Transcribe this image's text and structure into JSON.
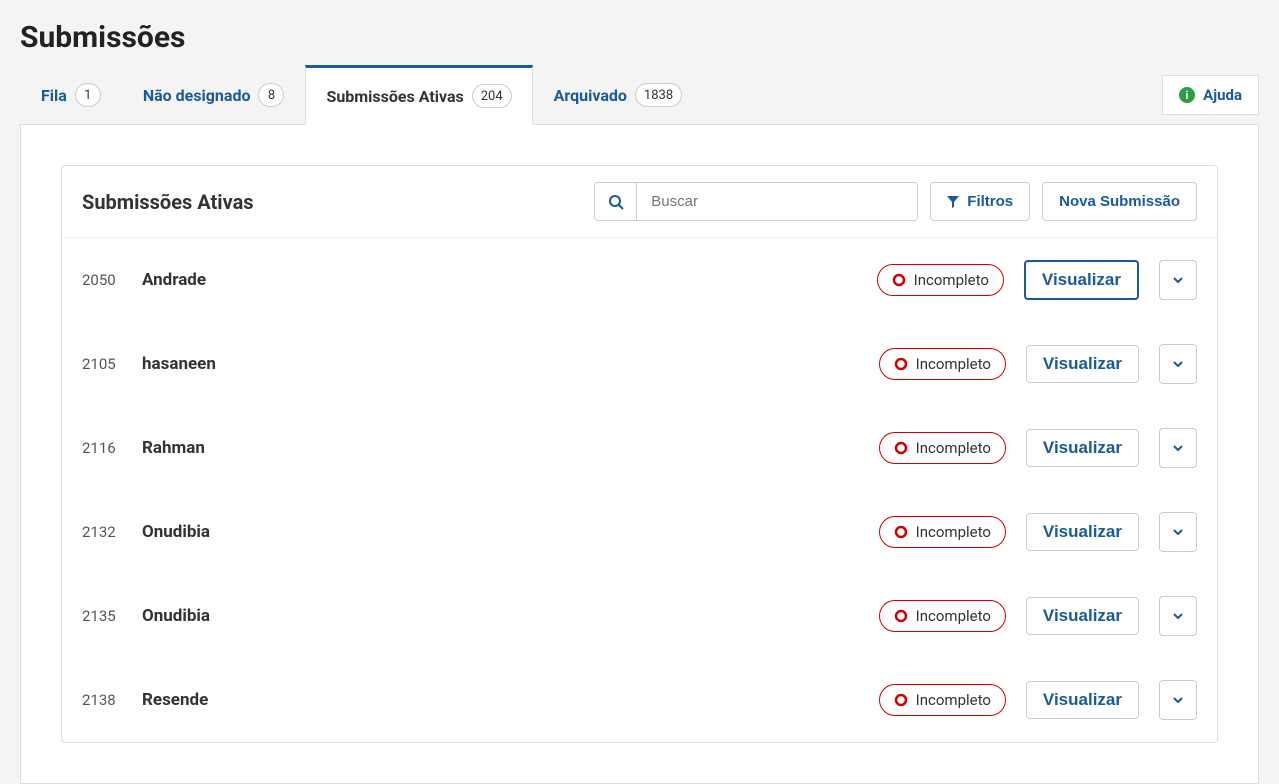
{
  "page": {
    "title": "Submissões"
  },
  "tabs": [
    {
      "label": "Fila",
      "count": "1",
      "active": false
    },
    {
      "label": "Não designado",
      "count": "8",
      "active": false
    },
    {
      "label": "Submissões Ativas",
      "count": "204",
      "active": true
    },
    {
      "label": "Arquivado",
      "count": "1838",
      "active": false
    }
  ],
  "help": {
    "label": "Ajuda"
  },
  "panel": {
    "title": "Submissões Ativas",
    "search_placeholder": "Buscar",
    "filters_label": "Filtros",
    "new_submission_label": "Nova Submissão"
  },
  "status": {
    "incomplete": "Incompleto"
  },
  "actions": {
    "view": "Visualizar"
  },
  "submissions": [
    {
      "id": "2050",
      "author": "Andrade",
      "status": "Incompleto",
      "focused": true
    },
    {
      "id": "2105",
      "author": "hasaneen",
      "status": "Incompleto",
      "focused": false
    },
    {
      "id": "2116",
      "author": "Rahman",
      "status": "Incompleto",
      "focused": false
    },
    {
      "id": "2132",
      "author": "Onudibia",
      "status": "Incompleto",
      "focused": false
    },
    {
      "id": "2135",
      "author": "Onudibia",
      "status": "Incompleto",
      "focused": false
    },
    {
      "id": "2138",
      "author": "Resende",
      "status": "Incompleto",
      "focused": false
    }
  ]
}
